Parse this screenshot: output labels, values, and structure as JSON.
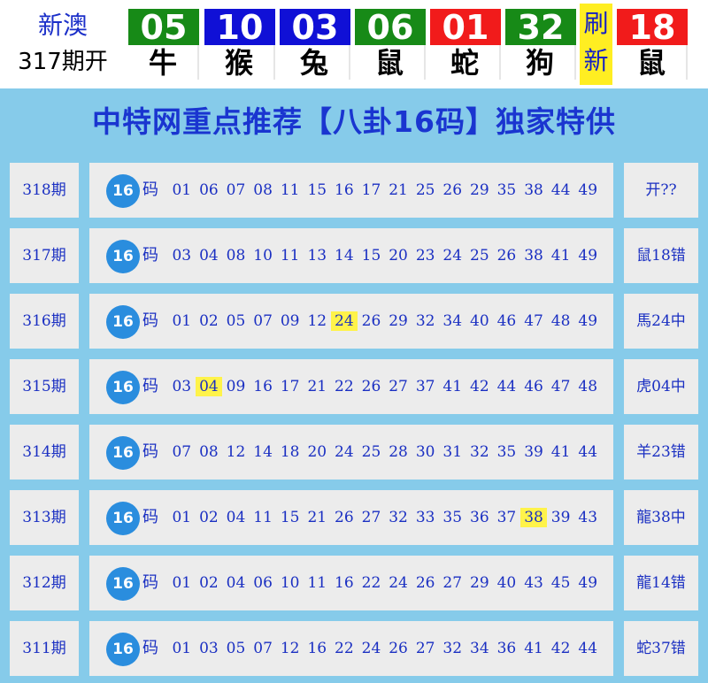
{
  "header": {
    "site_name": "新澳",
    "period_label": "317期开",
    "balls": [
      {
        "num": "05",
        "zodiac": "牛",
        "color": "#178a17"
      },
      {
        "num": "10",
        "zodiac": "猴",
        "color": "#1010d6"
      },
      {
        "num": "03",
        "zodiac": "兔",
        "color": "#1010d6"
      },
      {
        "num": "06",
        "zodiac": "鼠",
        "color": "#178a17"
      },
      {
        "num": "01",
        "zodiac": "蛇",
        "color": "#f11b1b"
      },
      {
        "num": "32",
        "zodiac": "狗",
        "color": "#178a17"
      }
    ],
    "refresh_label": "刷新",
    "special": {
      "num": "18",
      "zodiac": "鼠",
      "color": "#f11b1b"
    }
  },
  "banner": {
    "title": "中特网重点推荐【八卦16码】独家特供"
  },
  "table": {
    "badge_label": "16",
    "ma_label": "码",
    "rows": [
      {
        "period": "318期",
        "numbers": [
          "01",
          "06",
          "07",
          "08",
          "11",
          "15",
          "16",
          "17",
          "21",
          "25",
          "26",
          "29",
          "35",
          "38",
          "44",
          "49"
        ],
        "highlight": null,
        "result": "开??"
      },
      {
        "period": "317期",
        "numbers": [
          "03",
          "04",
          "08",
          "10",
          "11",
          "13",
          "14",
          "15",
          "20",
          "23",
          "24",
          "25",
          "26",
          "38",
          "41",
          "49"
        ],
        "highlight": null,
        "result": "鼠18错"
      },
      {
        "period": "316期",
        "numbers": [
          "01",
          "02",
          "05",
          "07",
          "09",
          "12",
          "24",
          "26",
          "29",
          "32",
          "34",
          "40",
          "46",
          "47",
          "48",
          "49"
        ],
        "highlight": "24",
        "result": "馬24中"
      },
      {
        "period": "315期",
        "numbers": [
          "03",
          "04",
          "09",
          "16",
          "17",
          "21",
          "22",
          "26",
          "27",
          "37",
          "41",
          "42",
          "44",
          "46",
          "47",
          "48"
        ],
        "highlight": "04",
        "result": "虎04中"
      },
      {
        "period": "314期",
        "numbers": [
          "07",
          "08",
          "12",
          "14",
          "18",
          "20",
          "24",
          "25",
          "28",
          "30",
          "31",
          "32",
          "35",
          "39",
          "41",
          "44"
        ],
        "highlight": null,
        "result": "羊23错"
      },
      {
        "period": "313期",
        "numbers": [
          "01",
          "02",
          "04",
          "11",
          "15",
          "21",
          "26",
          "27",
          "32",
          "33",
          "35",
          "36",
          "37",
          "38",
          "39",
          "43"
        ],
        "highlight": "38",
        "result": "龍38中"
      },
      {
        "period": "312期",
        "numbers": [
          "01",
          "02",
          "04",
          "06",
          "10",
          "11",
          "16",
          "22",
          "24",
          "26",
          "27",
          "29",
          "40",
          "43",
          "45",
          "49"
        ],
        "highlight": null,
        "result": "龍14错"
      },
      {
        "period": "311期",
        "numbers": [
          "01",
          "03",
          "05",
          "07",
          "12",
          "16",
          "22",
          "24",
          "26",
          "27",
          "32",
          "34",
          "36",
          "41",
          "42",
          "44"
        ],
        "highlight": null,
        "result": "蛇37错"
      }
    ]
  },
  "colors": {
    "accent_blue": "#1a2fc2",
    "banner_bg": "#86cbea",
    "highlight": "#fff34a",
    "badge": "#2a8dde"
  }
}
